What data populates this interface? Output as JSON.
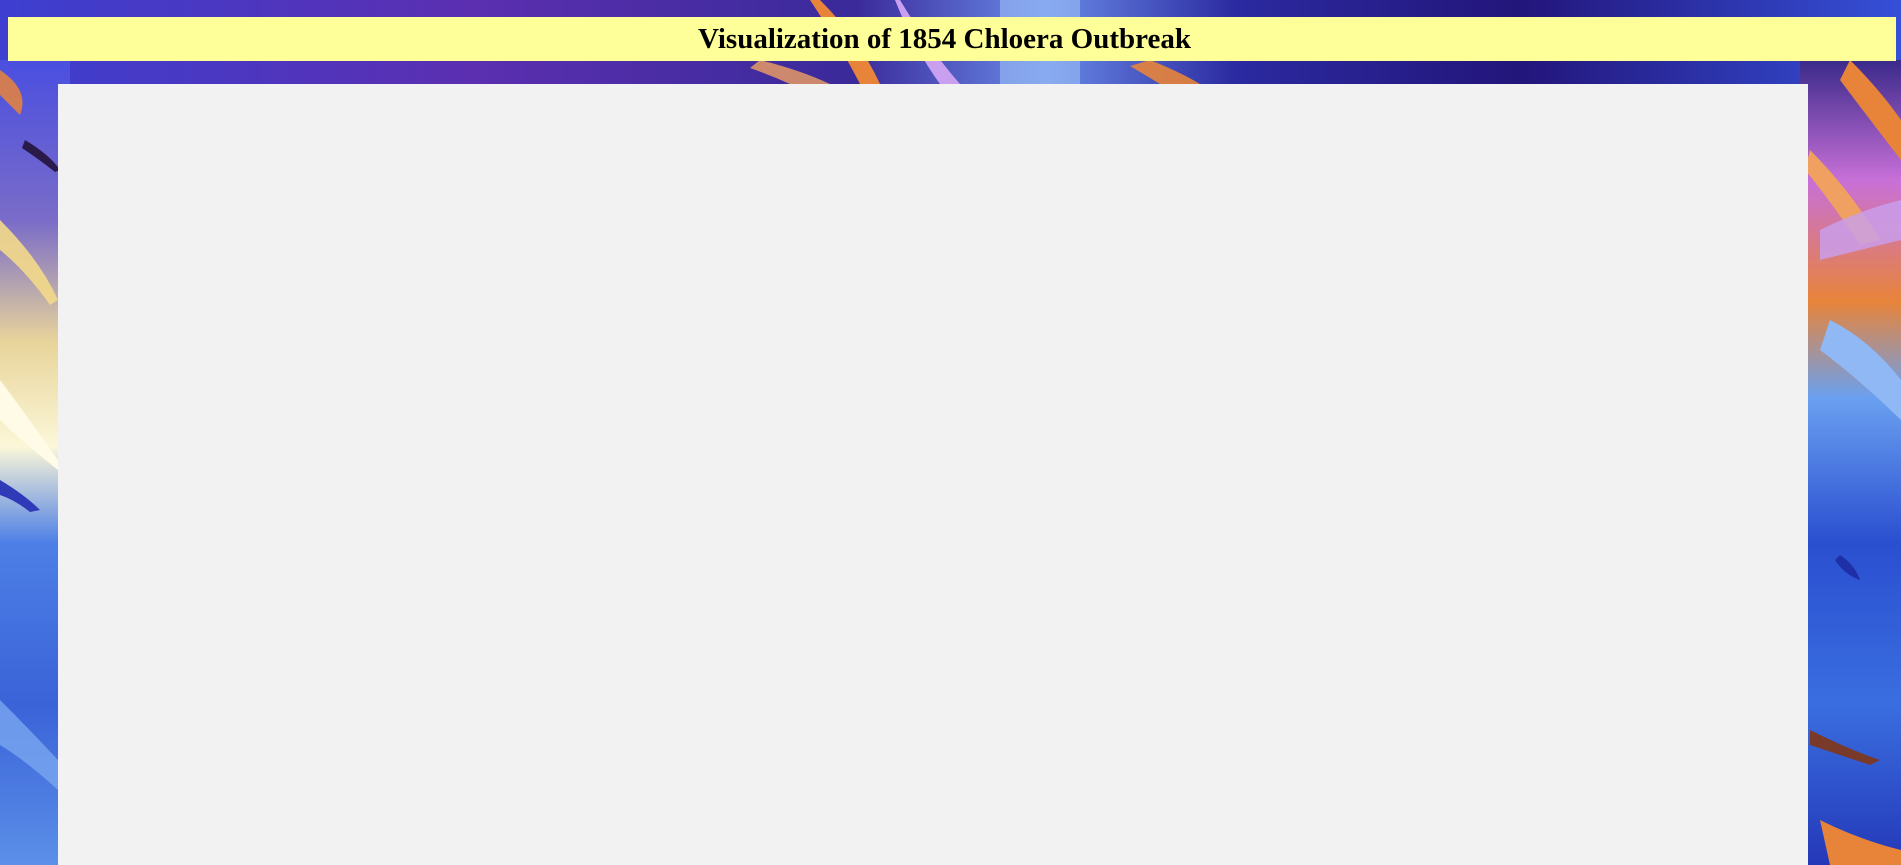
{
  "header": {
    "title": "Visualization of 1854 Chloera Outbreak"
  },
  "background": {
    "style": "abstract-painting",
    "colors": [
      "#3b52d6",
      "#2a1a8a",
      "#7b2fb8",
      "#e8843a",
      "#c9a0f0",
      "#f6e9a8",
      "#5a8de8",
      "#1e2fa8"
    ]
  },
  "map_panel": {
    "color": "#f2f2f2"
  }
}
